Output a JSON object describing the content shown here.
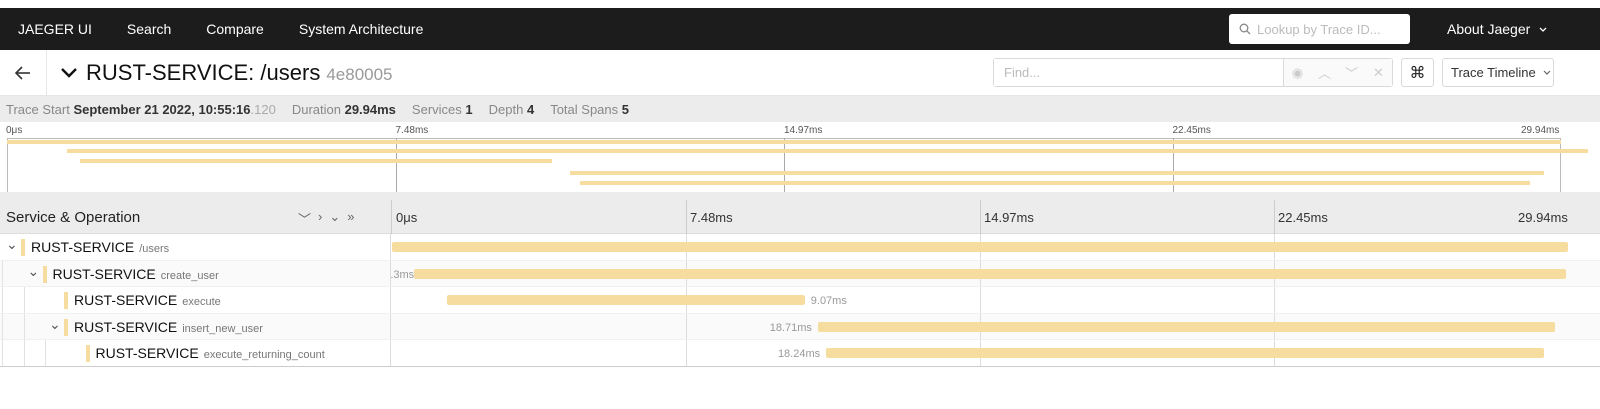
{
  "nav": {
    "brand": "JAEGER UI",
    "links": [
      "Search",
      "Compare",
      "System Architecture"
    ],
    "lookup_placeholder": "Lookup by Trace ID...",
    "about": "About Jaeger"
  },
  "trace": {
    "service": "RUST-SERVICE: /users",
    "trace_id": "4e80005",
    "find_placeholder": "Find...",
    "view_mode": "Trace Timeline",
    "cmd_glyph": "⌘"
  },
  "meta": {
    "trace_start_label": "Trace Start",
    "trace_start_value": "September 21 2022, 10:55:16",
    "trace_start_ms": ".120",
    "duration_label": "Duration",
    "duration_value": "29.94ms",
    "services_label": "Services",
    "services_value": "1",
    "depth_label": "Depth",
    "depth_value": "4",
    "total_spans_label": "Total Spans",
    "total_spans_value": "5"
  },
  "ticks": [
    "0μs",
    "7.48ms",
    "14.97ms",
    "22.45ms",
    "29.94ms"
  ],
  "header": {
    "title": "Service & Operation"
  },
  "spans": [
    {
      "service": "RUST-SERVICE",
      "operation": "/users",
      "start": 0,
      "end": 1.0,
      "label": "",
      "depth": 0,
      "toggle": true
    },
    {
      "service": "RUST-SERVICE",
      "operation": "create_user",
      "start": 0.019,
      "end": 0.998,
      "label": ".3ms",
      "depth": 1,
      "toggle": true
    },
    {
      "service": "RUST-SERVICE",
      "operation": "execute",
      "start": 0.047,
      "end": 0.351,
      "label": "9.07ms",
      "depth": 2,
      "toggle": false
    },
    {
      "service": "RUST-SERVICE",
      "operation": "insert_new_user",
      "start": 0.362,
      "end": 0.989,
      "label": "18.71ms",
      "depth": 2,
      "toggle": true
    },
    {
      "service": "RUST-SERVICE",
      "operation": "execute_returning_count",
      "start": 0.369,
      "end": 0.98,
      "label": "18.24ms",
      "depth": 3,
      "toggle": false
    }
  ],
  "colors": {
    "nav_bg": "#1c1c1c",
    "span_color": "#f7dca0"
  }
}
